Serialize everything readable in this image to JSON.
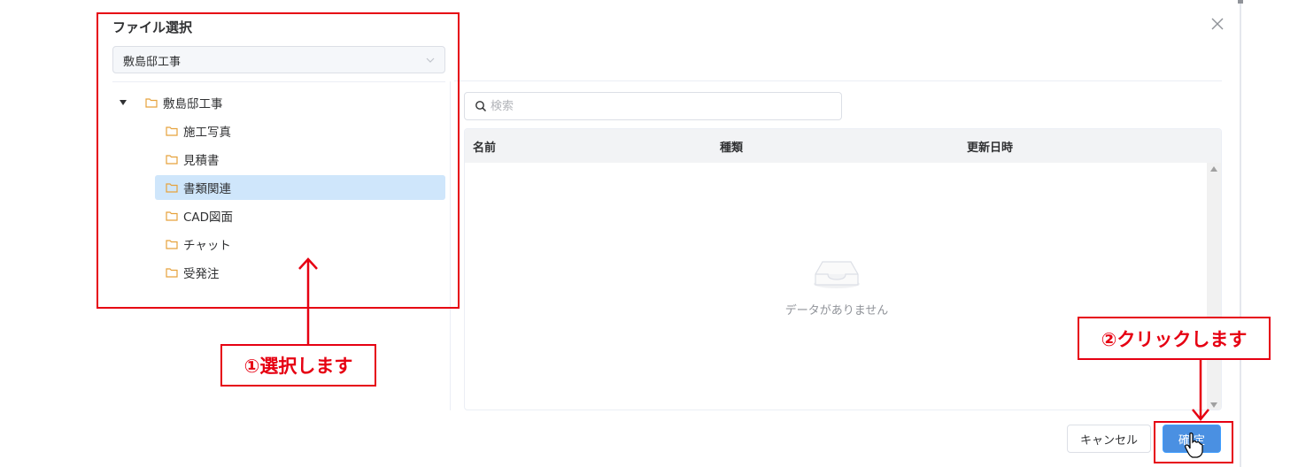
{
  "dialog": {
    "title": "ファイル選択",
    "project_select": {
      "value": "敷島邸工事"
    }
  },
  "tree": {
    "root": {
      "label": "敷島邸工事",
      "expanded": true
    },
    "children": [
      {
        "label": "施工写真",
        "selected": false
      },
      {
        "label": "見積書",
        "selected": false
      },
      {
        "label": "書類関連",
        "selected": true
      },
      {
        "label": "CAD図面",
        "selected": false
      },
      {
        "label": "チャット",
        "selected": false
      },
      {
        "label": "受発注",
        "selected": false
      }
    ]
  },
  "search": {
    "placeholder": "検索",
    "value": ""
  },
  "table": {
    "columns": [
      "名前",
      "種類",
      "更新日時"
    ],
    "rows": [],
    "empty_text": "データがありません"
  },
  "footer": {
    "cancel_label": "キャンセル",
    "ok_label": "確 定"
  },
  "annotations": {
    "step1": "①選択します",
    "step2": "②クリックします",
    "color": "#e60012"
  },
  "colors": {
    "primary": "#4a90e2",
    "selected_row": "#cfe6fb",
    "folder_icon": "#e6a23c",
    "header_bg": "#f2f3f5"
  }
}
